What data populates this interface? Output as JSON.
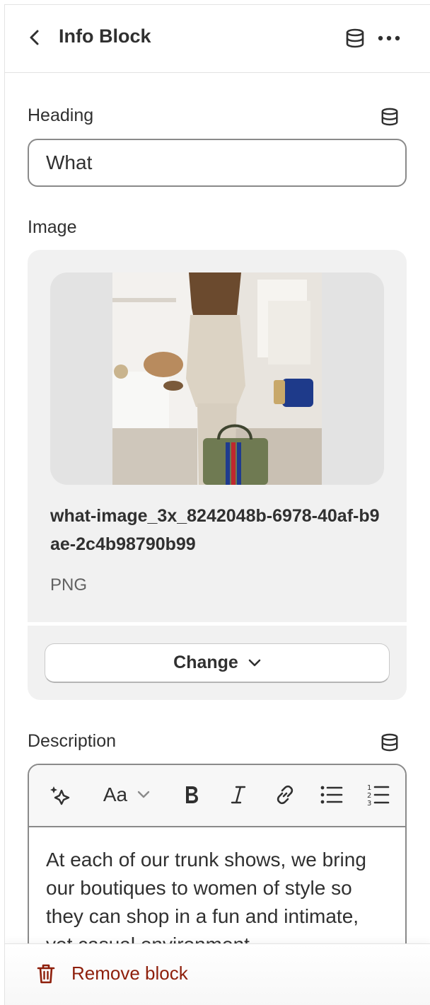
{
  "header": {
    "title": "Info Block"
  },
  "heading_field": {
    "label": "Heading",
    "value": "What"
  },
  "image_field": {
    "label": "Image",
    "file_name": "what-image_3x_8242048b-6978-40af-b9ae-2c4b98790b99",
    "file_type": "PNG",
    "change_label": "Change"
  },
  "description_field": {
    "label": "Description",
    "font_label": "Aa",
    "text": "At each of our trunk shows, we bring our boutiques to women of style so they can shop in a fun and intimate, yet casual environment."
  },
  "footer": {
    "remove_label": "Remove block"
  },
  "icons": {
    "back": "chevron-left-icon",
    "dynamic_source": "database-icon",
    "more": "more-horizontal-icon",
    "magic": "sparkle-icon",
    "bold": "bold-icon",
    "italic": "italic-icon",
    "link": "link-icon",
    "bullet_list": "bullet-list-icon",
    "number_list": "numbered-list-icon",
    "delete": "trash-icon"
  },
  "colors": {
    "danger": "#8e1f0b",
    "border": "#8a8a8a",
    "card": "#f1f1f1",
    "text": "#303030"
  }
}
